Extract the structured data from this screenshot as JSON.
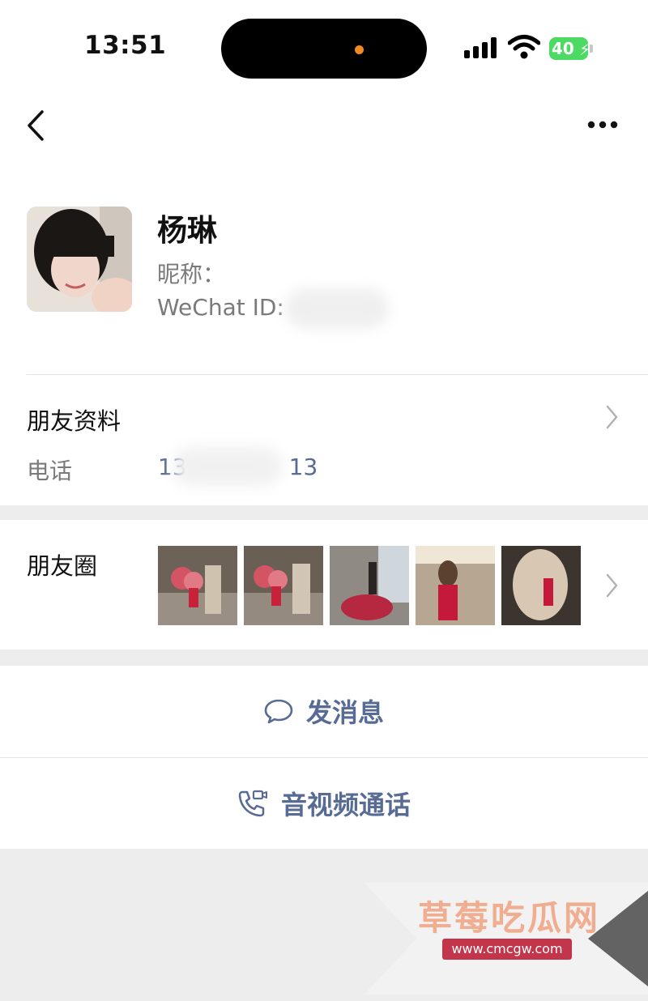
{
  "status_bar": {
    "time": "13:51",
    "battery": "40"
  },
  "nav": {
    "back_icon": "chevron-left-icon",
    "more_icon": "more-horizontal-icon"
  },
  "profile": {
    "name": "杨琳",
    "nickname_label": "昵称：",
    "wechat_id_label": "WeChat ID:"
  },
  "friend_info": {
    "label": "朋友资料",
    "phone_label": "电话",
    "phone_start": "13",
    "phone_end": "13"
  },
  "moments": {
    "label": "朋友圈",
    "thumbnail_count": 5
  },
  "actions": {
    "message_label": "发消息",
    "message_icon": "chat-bubble-icon",
    "call_label": "音视频通话",
    "call_icon": "phone-video-icon"
  },
  "watermark": {
    "title": "草莓吃瓜网",
    "url": "www.cmcgw.com"
  },
  "colors": {
    "link": "#576b95",
    "background": "#ededed",
    "battery": "#4cd964"
  }
}
